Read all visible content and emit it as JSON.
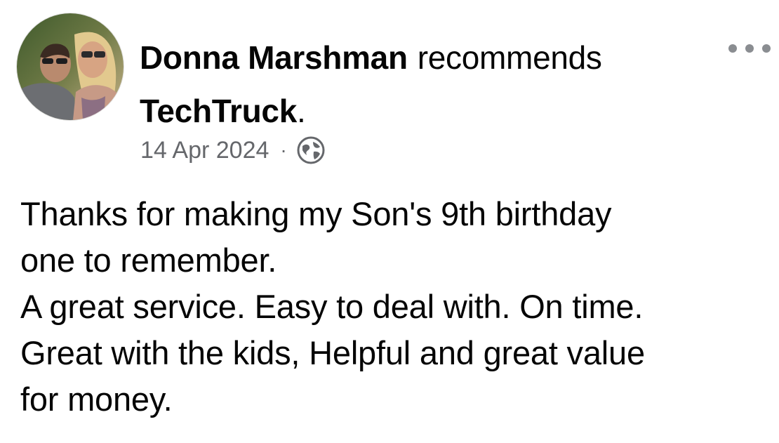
{
  "post": {
    "author": "Donna Marshman",
    "action": "recommends",
    "page_name": "TechTruck",
    "page_suffix": ".",
    "date": "14 Apr 2024",
    "separator": "·",
    "audience_icon": "globe-icon",
    "more_icon": "more-options-icon",
    "body_lines": [
      "Thanks for making my Son's 9th birthday",
      "one to remember.",
      "A great service. Easy to deal with. On time.",
      "Great with the kids, Helpful and great value",
      "for money."
    ]
  },
  "colors": {
    "text_primary": "#050505",
    "text_secondary": "#65676b",
    "icon_gray": "#8a8d91",
    "background": "#ffffff"
  }
}
